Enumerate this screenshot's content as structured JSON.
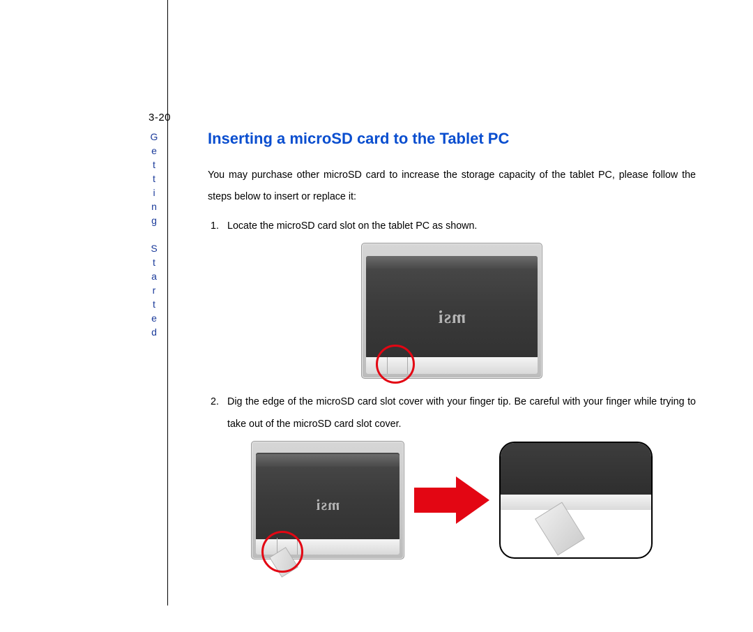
{
  "page_number": "3-20",
  "section_label": "Getting Started",
  "heading": "Inserting a microSD card to the Tablet PC",
  "intro": "You may purchase other microSD card to increase the storage capacity of the tablet PC, please follow the steps below to insert or replace it:",
  "steps": [
    "Locate the microSD card slot on the tablet PC as shown.",
    "Dig the edge of the microSD card slot cover with your finger tip. Be careful with your finger while trying to take out of the microSD card slot cover."
  ],
  "brand_label": "msi"
}
